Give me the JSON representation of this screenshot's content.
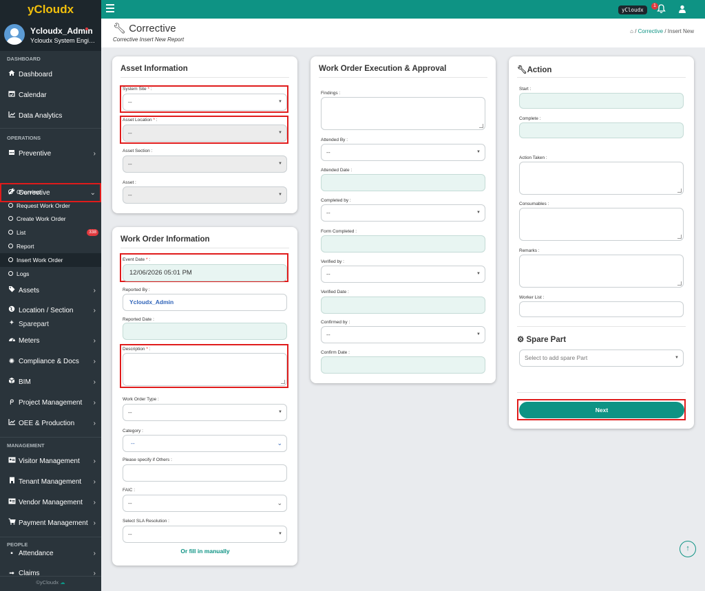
{
  "app": {
    "brand": "yCloudx",
    "tag": "yCloudx",
    "notif_count": "1"
  },
  "profile": {
    "name": "Ycloudx_Admin",
    "role": "Ycloudx System Engineer"
  },
  "sidebar": {
    "sections": [
      "DASHBOARD",
      "OPERATIONS",
      "MANAGEMENT",
      "PEOPLE"
    ],
    "dashboard": [
      {
        "label": "Dashboard",
        "icon": "home-icon"
      },
      {
        "label": "Calendar",
        "icon": "calendar-icon"
      },
      {
        "label": "Data Analytics",
        "icon": "chart-icon"
      }
    ],
    "operations": [
      {
        "label": "Preventive",
        "icon": "calendar-icon"
      },
      {
        "label": "Corrective",
        "icon": "wrench-icon"
      }
    ],
    "corrective_sub": [
      {
        "label": "Overview"
      },
      {
        "label": "Request Work Order"
      },
      {
        "label": "Create Work Order"
      },
      {
        "label": "List",
        "count": "338"
      },
      {
        "label": "Report"
      },
      {
        "label": "Insert Work Order"
      },
      {
        "label": "Logs"
      }
    ],
    "more": [
      {
        "label": "Assets",
        "icon": "tag-icon"
      },
      {
        "label": "Location / Section",
        "icon": "globe-icon"
      },
      {
        "label": "Sparepart",
        "icon": "gear-icon"
      },
      {
        "label": "Meters",
        "icon": "gauge-icon"
      },
      {
        "label": "Compliance & Docs",
        "icon": "badge-icon"
      },
      {
        "label": "BIM",
        "icon": "cube-icon"
      },
      {
        "label": "Project Management",
        "icon": "p-icon"
      },
      {
        "label": "OEE & Production",
        "icon": "chart-icon"
      }
    ],
    "management": [
      {
        "label": "Visitor Management",
        "icon": "id-card-icon"
      },
      {
        "label": "Tenant Management",
        "icon": "building-icon"
      },
      {
        "label": "Vendor Management",
        "icon": "id-card-icon"
      },
      {
        "label": "Payment Management",
        "icon": "cart-icon"
      }
    ],
    "people": [
      {
        "label": "Attendance"
      },
      {
        "label": "Claims"
      }
    ],
    "footer": "©yCloudx"
  },
  "header": {
    "title": "Corrective",
    "subtitle": "Corrective Insert New Report",
    "crumb": [
      "Corrective",
      "Insert New"
    ]
  },
  "asset": {
    "title": "Asset Information",
    "system_site": "System Site",
    "asset_location": "Asset Location",
    "asset_section": "Asset Section :",
    "asset": "Asset :",
    "placeholder": "--"
  },
  "wo": {
    "title": "Work Order Information",
    "event_date": "Event Date",
    "event_date_value": "12/06/2026 05:01 PM",
    "reported_by": "Reported By :",
    "reported_by_value": "Ycloudx_Admin",
    "reported_date": "Reported Date :",
    "description": "Description",
    "wo_type": "Work Order Type :",
    "category": "Category :",
    "others": "Please specify if Others :",
    "faic": "FAIC :",
    "sla": "Select SLA Resolution :",
    "manual": "Or fill in manually",
    "placeholder": "--"
  },
  "exec": {
    "title": "Work Order Execution & Approval",
    "findings": "Findings :",
    "attended_by": "Attended By :",
    "attended_date": "Attended Date :",
    "completed_by": "Completed by :",
    "form_completed": "Form Completed :",
    "verified_by": "Verified by :",
    "verified_date": "Verified Date :",
    "confirmed_by": "Confirmed by :",
    "confirm_date": "Confirm Date :",
    "placeholder": "--"
  },
  "action": {
    "title": "Action",
    "start": "Start :",
    "complete": "Complete :",
    "action_taken": "Action Taken :",
    "consumables": "Consumables :",
    "remarks": "Remarks :",
    "worker_list": "Worker List :",
    "spare_title": "Spare Part",
    "spare_placeholder": "Select to add spare Part",
    "next": "Next"
  },
  "colors": {
    "accent": "#0e9384",
    "sidebar": "#2a343b",
    "brand_text": "#f2c00c",
    "highlight": "#e01b1b"
  }
}
